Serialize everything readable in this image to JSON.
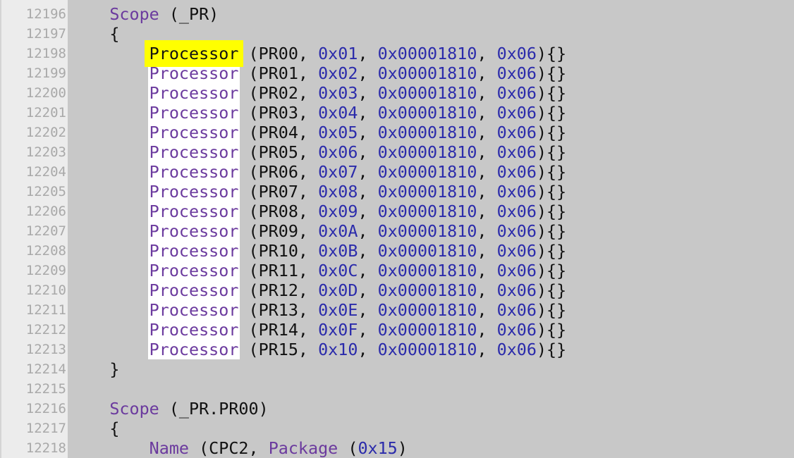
{
  "editor": {
    "colors": {
      "keyword": "#6b3a9e",
      "number": "#2b2bab",
      "text": "#111111",
      "search_current": "#ffff00",
      "search_match": "#ffffff"
    },
    "lines": [
      {
        "number": "12196",
        "indent": 4,
        "tokens": [
          {
            "t": "Scope",
            "c": "kw"
          },
          {
            "t": " (_PR)",
            "c": "pl"
          }
        ]
      },
      {
        "number": "12197",
        "indent": 4,
        "tokens": [
          {
            "t": "{",
            "c": "pl"
          }
        ]
      },
      {
        "number": "12198",
        "indent": 8,
        "tokens": [
          {
            "t": "Processor",
            "c": "kw",
            "hl": "current"
          },
          {
            "t": " (PR00, ",
            "c": "pl"
          },
          {
            "t": "0x01",
            "c": "num"
          },
          {
            "t": ", ",
            "c": "pl"
          },
          {
            "t": "0x00001810",
            "c": "num"
          },
          {
            "t": ", ",
            "c": "pl"
          },
          {
            "t": "0x06",
            "c": "num"
          },
          {
            "t": "){}",
            "c": "pl"
          }
        ]
      },
      {
        "number": "12199",
        "indent": 8,
        "tokens": [
          {
            "t": "Processor",
            "c": "kw",
            "hl": "match"
          },
          {
            "t": " (PR01, ",
            "c": "pl"
          },
          {
            "t": "0x02",
            "c": "num"
          },
          {
            "t": ", ",
            "c": "pl"
          },
          {
            "t": "0x00001810",
            "c": "num"
          },
          {
            "t": ", ",
            "c": "pl"
          },
          {
            "t": "0x06",
            "c": "num"
          },
          {
            "t": "){}",
            "c": "pl"
          }
        ]
      },
      {
        "number": "12200",
        "indent": 8,
        "tokens": [
          {
            "t": "Processor",
            "c": "kw",
            "hl": "match"
          },
          {
            "t": " (PR02, ",
            "c": "pl"
          },
          {
            "t": "0x03",
            "c": "num"
          },
          {
            "t": ", ",
            "c": "pl"
          },
          {
            "t": "0x00001810",
            "c": "num"
          },
          {
            "t": ", ",
            "c": "pl"
          },
          {
            "t": "0x06",
            "c": "num"
          },
          {
            "t": "){}",
            "c": "pl"
          }
        ]
      },
      {
        "number": "12201",
        "indent": 8,
        "tokens": [
          {
            "t": "Processor",
            "c": "kw",
            "hl": "match"
          },
          {
            "t": " (PR03, ",
            "c": "pl"
          },
          {
            "t": "0x04",
            "c": "num"
          },
          {
            "t": ", ",
            "c": "pl"
          },
          {
            "t": "0x00001810",
            "c": "num"
          },
          {
            "t": ", ",
            "c": "pl"
          },
          {
            "t": "0x06",
            "c": "num"
          },
          {
            "t": "){}",
            "c": "pl"
          }
        ]
      },
      {
        "number": "12202",
        "indent": 8,
        "tokens": [
          {
            "t": "Processor",
            "c": "kw",
            "hl": "match"
          },
          {
            "t": " (PR04, ",
            "c": "pl"
          },
          {
            "t": "0x05",
            "c": "num"
          },
          {
            "t": ", ",
            "c": "pl"
          },
          {
            "t": "0x00001810",
            "c": "num"
          },
          {
            "t": ", ",
            "c": "pl"
          },
          {
            "t": "0x06",
            "c": "num"
          },
          {
            "t": "){}",
            "c": "pl"
          }
        ]
      },
      {
        "number": "12203",
        "indent": 8,
        "tokens": [
          {
            "t": "Processor",
            "c": "kw",
            "hl": "match"
          },
          {
            "t": " (PR05, ",
            "c": "pl"
          },
          {
            "t": "0x06",
            "c": "num"
          },
          {
            "t": ", ",
            "c": "pl"
          },
          {
            "t": "0x00001810",
            "c": "num"
          },
          {
            "t": ", ",
            "c": "pl"
          },
          {
            "t": "0x06",
            "c": "num"
          },
          {
            "t": "){}",
            "c": "pl"
          }
        ]
      },
      {
        "number": "12204",
        "indent": 8,
        "tokens": [
          {
            "t": "Processor",
            "c": "kw",
            "hl": "match"
          },
          {
            "t": " (PR06, ",
            "c": "pl"
          },
          {
            "t": "0x07",
            "c": "num"
          },
          {
            "t": ", ",
            "c": "pl"
          },
          {
            "t": "0x00001810",
            "c": "num"
          },
          {
            "t": ", ",
            "c": "pl"
          },
          {
            "t": "0x06",
            "c": "num"
          },
          {
            "t": "){}",
            "c": "pl"
          }
        ]
      },
      {
        "number": "12205",
        "indent": 8,
        "tokens": [
          {
            "t": "Processor",
            "c": "kw",
            "hl": "match"
          },
          {
            "t": " (PR07, ",
            "c": "pl"
          },
          {
            "t": "0x08",
            "c": "num"
          },
          {
            "t": ", ",
            "c": "pl"
          },
          {
            "t": "0x00001810",
            "c": "num"
          },
          {
            "t": ", ",
            "c": "pl"
          },
          {
            "t": "0x06",
            "c": "num"
          },
          {
            "t": "){}",
            "c": "pl"
          }
        ]
      },
      {
        "number": "12206",
        "indent": 8,
        "tokens": [
          {
            "t": "Processor",
            "c": "kw",
            "hl": "match"
          },
          {
            "t": " (PR08, ",
            "c": "pl"
          },
          {
            "t": "0x09",
            "c": "num"
          },
          {
            "t": ", ",
            "c": "pl"
          },
          {
            "t": "0x00001810",
            "c": "num"
          },
          {
            "t": ", ",
            "c": "pl"
          },
          {
            "t": "0x06",
            "c": "num"
          },
          {
            "t": "){}",
            "c": "pl"
          }
        ]
      },
      {
        "number": "12207",
        "indent": 8,
        "tokens": [
          {
            "t": "Processor",
            "c": "kw",
            "hl": "match"
          },
          {
            "t": " (PR09, ",
            "c": "pl"
          },
          {
            "t": "0x0A",
            "c": "num"
          },
          {
            "t": ", ",
            "c": "pl"
          },
          {
            "t": "0x00001810",
            "c": "num"
          },
          {
            "t": ", ",
            "c": "pl"
          },
          {
            "t": "0x06",
            "c": "num"
          },
          {
            "t": "){}",
            "c": "pl"
          }
        ]
      },
      {
        "number": "12208",
        "indent": 8,
        "tokens": [
          {
            "t": "Processor",
            "c": "kw",
            "hl": "match"
          },
          {
            "t": " (PR10, ",
            "c": "pl"
          },
          {
            "t": "0x0B",
            "c": "num"
          },
          {
            "t": ", ",
            "c": "pl"
          },
          {
            "t": "0x00001810",
            "c": "num"
          },
          {
            "t": ", ",
            "c": "pl"
          },
          {
            "t": "0x06",
            "c": "num"
          },
          {
            "t": "){}",
            "c": "pl"
          }
        ]
      },
      {
        "number": "12209",
        "indent": 8,
        "tokens": [
          {
            "t": "Processor",
            "c": "kw",
            "hl": "match"
          },
          {
            "t": " (PR11, ",
            "c": "pl"
          },
          {
            "t": "0x0C",
            "c": "num"
          },
          {
            "t": ", ",
            "c": "pl"
          },
          {
            "t": "0x00001810",
            "c": "num"
          },
          {
            "t": ", ",
            "c": "pl"
          },
          {
            "t": "0x06",
            "c": "num"
          },
          {
            "t": "){}",
            "c": "pl"
          }
        ]
      },
      {
        "number": "12210",
        "indent": 8,
        "tokens": [
          {
            "t": "Processor",
            "c": "kw",
            "hl": "match"
          },
          {
            "t": " (PR12, ",
            "c": "pl"
          },
          {
            "t": "0x0D",
            "c": "num"
          },
          {
            "t": ", ",
            "c": "pl"
          },
          {
            "t": "0x00001810",
            "c": "num"
          },
          {
            "t": ", ",
            "c": "pl"
          },
          {
            "t": "0x06",
            "c": "num"
          },
          {
            "t": "){}",
            "c": "pl"
          }
        ]
      },
      {
        "number": "12211",
        "indent": 8,
        "tokens": [
          {
            "t": "Processor",
            "c": "kw",
            "hl": "match"
          },
          {
            "t": " (PR13, ",
            "c": "pl"
          },
          {
            "t": "0x0E",
            "c": "num"
          },
          {
            "t": ", ",
            "c": "pl"
          },
          {
            "t": "0x00001810",
            "c": "num"
          },
          {
            "t": ", ",
            "c": "pl"
          },
          {
            "t": "0x06",
            "c": "num"
          },
          {
            "t": "){}",
            "c": "pl"
          }
        ]
      },
      {
        "number": "12212",
        "indent": 8,
        "tokens": [
          {
            "t": "Processor",
            "c": "kw",
            "hl": "match"
          },
          {
            "t": " (PR14, ",
            "c": "pl"
          },
          {
            "t": "0x0F",
            "c": "num"
          },
          {
            "t": ", ",
            "c": "pl"
          },
          {
            "t": "0x00001810",
            "c": "num"
          },
          {
            "t": ", ",
            "c": "pl"
          },
          {
            "t": "0x06",
            "c": "num"
          },
          {
            "t": "){}",
            "c": "pl"
          }
        ]
      },
      {
        "number": "12213",
        "indent": 8,
        "tokens": [
          {
            "t": "Processor",
            "c": "kw",
            "hl": "match"
          },
          {
            "t": " (PR15, ",
            "c": "pl"
          },
          {
            "t": "0x10",
            "c": "num"
          },
          {
            "t": ", ",
            "c": "pl"
          },
          {
            "t": "0x00001810",
            "c": "num"
          },
          {
            "t": ", ",
            "c": "pl"
          },
          {
            "t": "0x06",
            "c": "num"
          },
          {
            "t": "){}",
            "c": "pl"
          }
        ]
      },
      {
        "number": "12214",
        "indent": 4,
        "tokens": [
          {
            "t": "}",
            "c": "pl"
          }
        ]
      },
      {
        "number": "12215",
        "indent": 0,
        "tokens": []
      },
      {
        "number": "12216",
        "indent": 4,
        "tokens": [
          {
            "t": "Scope",
            "c": "kw"
          },
          {
            "t": " (_PR.PR00)",
            "c": "pl"
          }
        ]
      },
      {
        "number": "12217",
        "indent": 4,
        "tokens": [
          {
            "t": "{",
            "c": "pl"
          }
        ]
      },
      {
        "number": "12218",
        "indent": 8,
        "tokens": [
          {
            "t": "Name",
            "c": "kw"
          },
          {
            "t": " (CPC2, ",
            "c": "pl"
          },
          {
            "t": "Package",
            "c": "kw"
          },
          {
            "t": " (",
            "c": "pl"
          },
          {
            "t": "0x15",
            "c": "num"
          },
          {
            "t": ")",
            "c": "pl"
          }
        ]
      }
    ]
  }
}
